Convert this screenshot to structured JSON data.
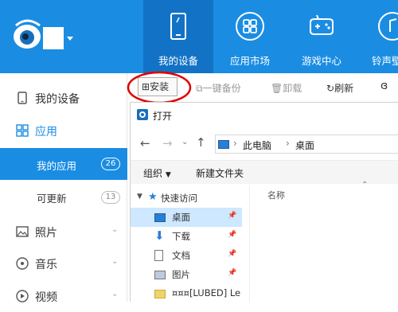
{
  "top_nav": {
    "tabs": [
      {
        "label": "我的设备",
        "icon": "tablet-icon"
      },
      {
        "label": "应用市场",
        "icon": "app-grid-icon"
      },
      {
        "label": "游戏中心",
        "icon": "gamepad-icon"
      },
      {
        "label": "铃声壁",
        "icon": "music-icon"
      }
    ],
    "colors": {
      "bar": "#1a8de3",
      "active": "#1273c6"
    }
  },
  "sidebar": {
    "items": [
      {
        "label": "我的设备",
        "icon": "phone-icon"
      },
      {
        "label": "应用",
        "icon": "apps-icon"
      },
      {
        "label": "我的应用",
        "badge": "26"
      },
      {
        "label": "可更新",
        "badge": "13"
      },
      {
        "label": "照片",
        "icon": "photo-icon"
      },
      {
        "label": "音乐",
        "icon": "music-note-icon"
      },
      {
        "label": "视频",
        "icon": "video-icon"
      }
    ]
  },
  "toolbar": {
    "install": "安装",
    "backup": "一键备份",
    "uninstall": "卸载",
    "refresh": "刷新"
  },
  "dialog": {
    "title": "打开",
    "path": [
      "此电脑",
      "桌面"
    ],
    "organize": "组织",
    "new_folder": "新建文件夹",
    "column_name": "名称",
    "tree": [
      {
        "label": "快速访问"
      },
      {
        "label": "桌面"
      },
      {
        "label": "下载"
      },
      {
        "label": "文档"
      },
      {
        "label": "图片"
      },
      {
        "label": "¤¤¤[LUBED] Le"
      }
    ]
  }
}
